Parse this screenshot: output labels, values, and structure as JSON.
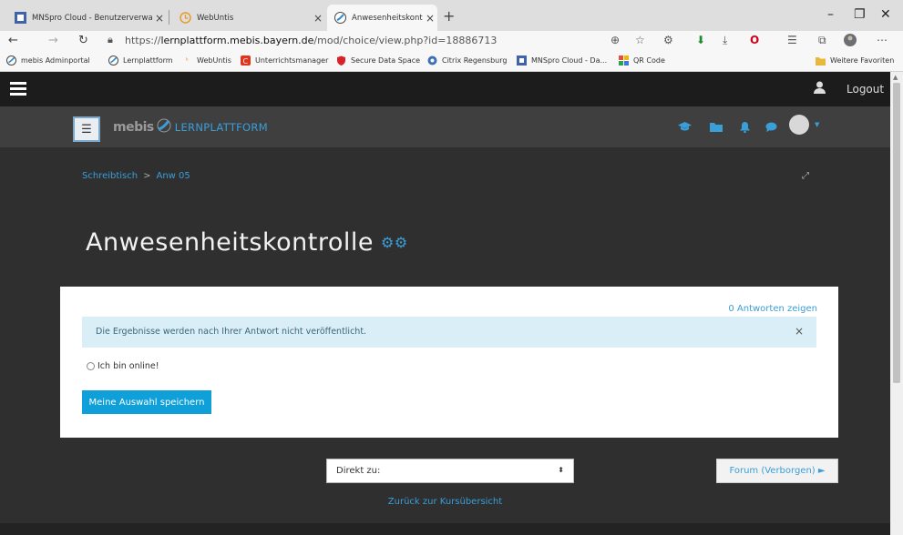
{
  "browser": {
    "tabs": [
      {
        "title": "MNSpro Cloud - Benutzerverwal",
        "close": "×",
        "favicon": "mnspro-icon",
        "active": false
      },
      {
        "title": "WebUntis",
        "close": "×",
        "favicon": "webuntis-icon",
        "active": false
      },
      {
        "title": "Anwesenheitskontrolle",
        "close": "×",
        "favicon": "mebis-icon",
        "active": true
      }
    ],
    "new_tab": "+",
    "window_controls": {
      "minimize": "–",
      "maximize": "❐",
      "close": "✕"
    },
    "url_prefix": "https://",
    "url_host": "lernplattform.mebis.bayern.de",
    "url_path": "/mod/choice/view.php?id=18886713",
    "bookmarks": [
      {
        "label": "mebis Adminportal",
        "icon": "mebis-icon"
      },
      {
        "label": "Lernplattform",
        "icon": "mebis-icon"
      },
      {
        "label": "WebUntis",
        "icon": "webuntis-icon"
      },
      {
        "label": "Unterrichtsmanager",
        "icon": "unterrichtsmanager-icon"
      },
      {
        "label": "Secure Data Space",
        "icon": "shield-icon"
      },
      {
        "label": "Citrix Regensburg",
        "icon": "citrix-icon"
      },
      {
        "label": "MNSpro Cloud - Da...",
        "icon": "mnspro-icon"
      },
      {
        "label": "QR Code",
        "icon": "qr-icon"
      }
    ],
    "other_favorites": "Weitere Favoriten"
  },
  "topbar": {
    "logout": "Logout"
  },
  "mebis": {
    "logo_mebis": "mebis",
    "logo_platform": "LERNPLATTFORM"
  },
  "breadcrumb": {
    "home": "Schreibtisch",
    "separator": ">",
    "course": "Anw 05"
  },
  "page": {
    "title": "Anwesenheitskontrolle"
  },
  "choice": {
    "answers_link": "0 Antworten zeigen",
    "alert_text": "Die Ergebnisse werden nach Ihrer Antwort nicht veröffentlicht.",
    "alert_close": "×",
    "option_label": "Ich bin online!",
    "save_button": "Meine Auswahl speichern"
  },
  "footer_nav": {
    "jump_select": "Direkt zu:",
    "next_activity": "Forum (Verborgen) ►",
    "back_link": "Zurück zur Kursübersicht"
  },
  "colors": {
    "accent": "#3a9ed8",
    "button": "#0f9fd9",
    "page_bg": "#2f2f2f",
    "alert_bg": "#d9eef6"
  }
}
